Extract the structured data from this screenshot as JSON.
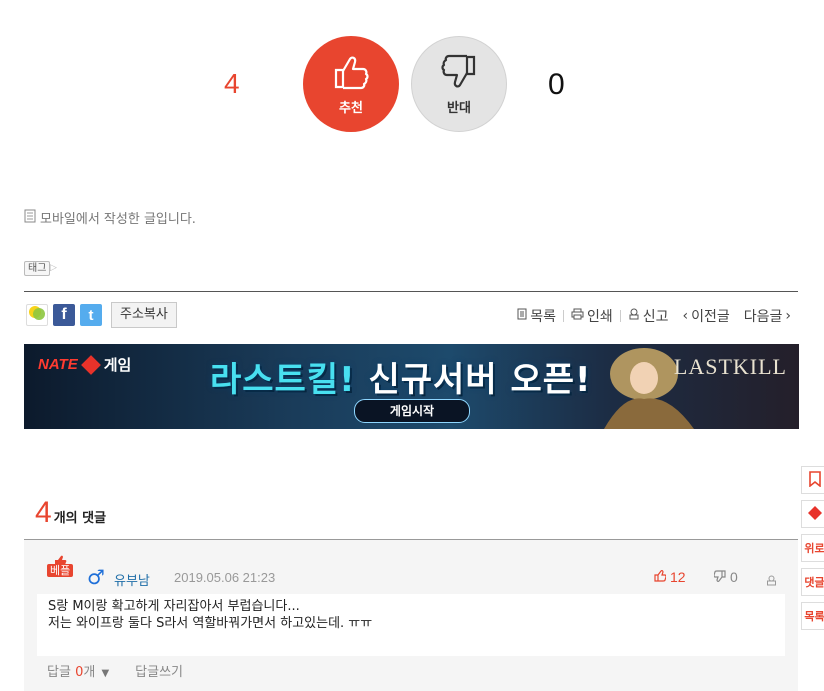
{
  "vote": {
    "up_count": "4",
    "up_label": "추천",
    "down_count": "0",
    "down_label": "반대"
  },
  "post": {
    "mobile_note": "모바일에서 작성한 글입니다.",
    "tag_label": "태그"
  },
  "share": {
    "copy_url_label": "주소복사"
  },
  "tools": {
    "list_label": "목록",
    "print_label": "인쇄",
    "report_label": "신고",
    "prev_label": "이전글",
    "next_label": "다음글"
  },
  "banner": {
    "brand": "NATE",
    "brand_suffix": "게임",
    "headline_part1": "라스트킬!",
    "headline_part2": "신규서버 오픈!",
    "cta": "게임시작",
    "logo": "LASTKILL"
  },
  "comments": {
    "count": "4",
    "count_label": "개의 댓글",
    "items": [
      {
        "badge": "베플",
        "gender": "♂",
        "author": "유부남",
        "date": "2019.05.06 21:23",
        "likes": "12",
        "dislikes": "0",
        "body_line1": "S랑 M이랑 확고하게 자리잡아서 부럽습니다...",
        "body_line2": "저는 와이프랑 둘다 S라서 역할바꿔가면서 하고있는데. ㅠㅠ",
        "reply_label": "답글",
        "reply_count": "0",
        "reply_unit": "개",
        "reply_write": "답글쓰기"
      }
    ]
  },
  "sidebar": {
    "item3": "위로",
    "item4": "댓글",
    "item5": "목록"
  },
  "colors": {
    "accent": "#e8452f",
    "link": "#1f6ea8"
  }
}
